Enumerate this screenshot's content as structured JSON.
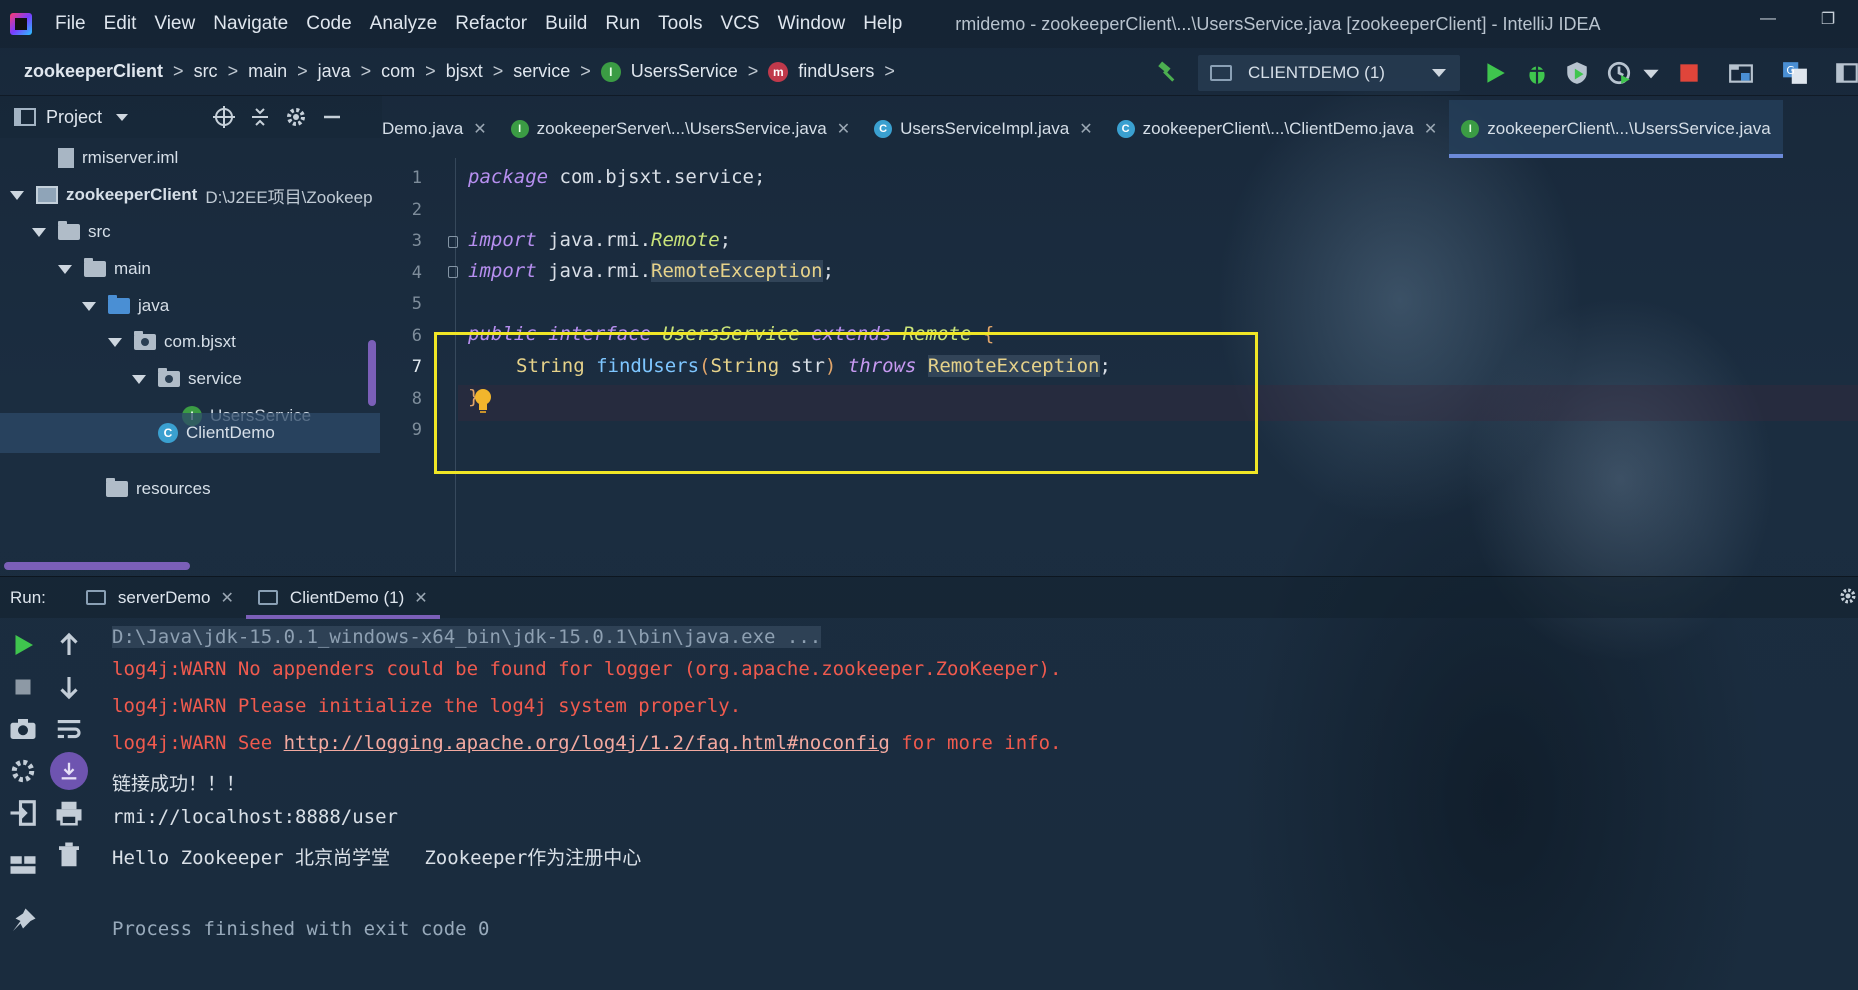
{
  "titlebar": {
    "menu": [
      "File",
      "Edit",
      "View",
      "Navigate",
      "Code",
      "Analyze",
      "Refactor",
      "Build",
      "Run",
      "Tools",
      "VCS",
      "Window",
      "Help"
    ],
    "window_title": "rmidemo - zookeeperClient\\...\\UsersService.java [zookeeperClient] - IntelliJ IDEA",
    "minimize": "—",
    "restore": "❐"
  },
  "breadcrumb": {
    "items": [
      "zookeeperClient",
      "src",
      "main",
      "java",
      "com",
      "bjsxt",
      "service",
      "UsersService",
      "findUsers"
    ],
    "sep": ">"
  },
  "toolbar": {
    "run_config": "CLIENTDEMO (1)"
  },
  "project": {
    "title": "Project",
    "tree": [
      {
        "label": "rmiserver.iml"
      },
      {
        "label": "zookeeperClient",
        "path": "D:\\J2EE项目\\Zookeep"
      },
      {
        "label": "src"
      },
      {
        "label": "main"
      },
      {
        "label": "java"
      },
      {
        "label": "com.bjsxt"
      },
      {
        "label": "service"
      },
      {
        "label": "UsersService"
      },
      {
        "label": "ClientDemo"
      },
      {
        "label": "resources"
      }
    ]
  },
  "tabs": [
    {
      "label": "Demo.java",
      "icon": ""
    },
    {
      "label": "zookeeperServer\\...\\UsersService.java",
      "icon": "I"
    },
    {
      "label": "UsersServiceImpl.java",
      "icon": "C"
    },
    {
      "label": "zookeeperClient\\...\\ClientDemo.java",
      "icon": "C"
    },
    {
      "label": "zookeeperClient\\...\\UsersService.java",
      "icon": "I"
    }
  ],
  "tab_close": "✕",
  "editor": {
    "line_numbers": [
      "1",
      "2",
      "3",
      "4",
      "5",
      "6",
      "7",
      "8",
      "9"
    ],
    "current_line": 7,
    "code": {
      "l1_kw": "package",
      "l1_rest": " com.bjsxt.service;",
      "l3_kw": "import",
      "l3_pkg": " java.rmi.",
      "l3_cls": "Remote",
      "l3_end": ";",
      "l4_kw": "import",
      "l4_pkg": " java.rmi.",
      "l4_cls": "RemoteException",
      "l4_end": ";",
      "l6_public": "public",
      "l6_interface": "interface",
      "l6_name": "UsersService",
      "l6_extends": "extends",
      "l6_parent": "Remote",
      "l6_brace": "{",
      "l7_type": "String",
      "l7_fn": "findUsers",
      "l7_open": "(",
      "l7_ptype": "String",
      "l7_pname": " str",
      "l7_close": ")",
      "l7_throws": "throws",
      "l7_exc": "RemoteException",
      "l7_end": ";",
      "l8_brace": "}"
    }
  },
  "run": {
    "label": "Run:",
    "tabs": [
      {
        "label": "serverDemo"
      },
      {
        "label": "ClientDemo (1)"
      }
    ],
    "console": {
      "cmd": "D:\\Java\\jdk-15.0.1_windows-x64_bin\\jdk-15.0.1\\bin\\java.exe ...",
      "warn1": "log4j:WARN No appenders could be found for logger (org.apache.zookeeper.ZooKeeper).",
      "warn2": "log4j:WARN Please initialize the log4j system properly.",
      "warn3_pre": "log4j:WARN See ",
      "warn3_link": "http://logging.apache.org/log4j/1.2/faq.html#noconfig",
      "warn3_post": " for more info.",
      "out1": "链接成功！！！",
      "out2": "rmi://localhost:8888/user",
      "out3": "Hello Zookeeper 北京尚学堂   Zookeeper作为注册中心",
      "exit": "Process finished with exit code 0"
    }
  },
  "colors": {
    "accent_tab": "#6c8ad8",
    "highlight_box": "#f0e626",
    "warn": "#f05a4e",
    "run_green": "#3fc54e",
    "stop_red": "#e0453a"
  },
  "icons": [
    "app-logo",
    "hammer-icon",
    "run-icon",
    "debug-icon",
    "coverage-icon",
    "profile-icon",
    "stop-icon",
    "project-structure-icon",
    "translate-icon",
    "globe-icon",
    "gear-icon",
    "collapse-icon",
    "minimize-icon",
    "lightbulb-icon"
  ]
}
